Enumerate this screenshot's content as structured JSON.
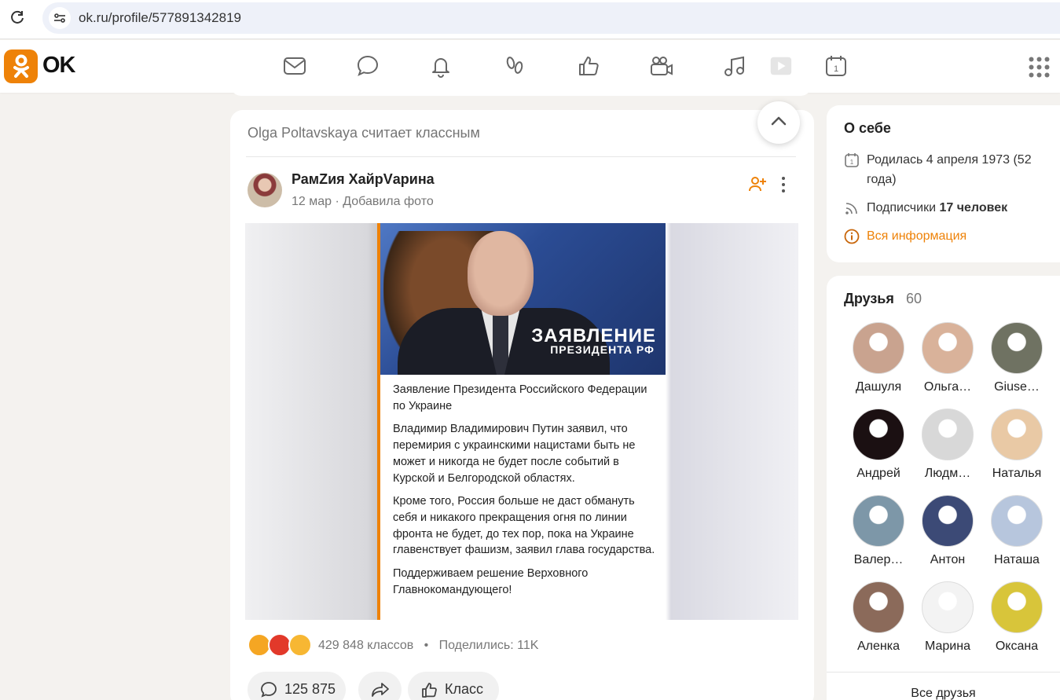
{
  "browser": {
    "url": "ok.ru/profile/577891342819"
  },
  "nav": {
    "logo_text": "OK",
    "icons": [
      "mail-icon",
      "chat-icon",
      "bell-icon",
      "guests-icon",
      "like-icon",
      "video-camera-icon",
      "music-icon",
      "video-play-icon",
      "calendar-icon"
    ]
  },
  "post": {
    "header": "Olga Poltavskaya считает классным",
    "author": "РамZия ХайрVарина",
    "meta": "12 мар · Добавила фото",
    "image": {
      "title": "ЗАЯВЛЕНИЕ",
      "subtitle": "ПРЕЗИДЕНТА РФ",
      "paragraphs": [
        "Заявление Президента Российского Федерации по Украине",
        "Владимир Владимирович Путин заявил, что перемирия с украинскими нацистами быть не может и никогда не будет после событий в Курской и Белгородской областях.",
        "Кроме того, Россия больше не даст обмануть себя и никакого прекращения огня по линии фронта не будет, до тех пор, пока на Украине главенствует фашизм, заявил глава государства.",
        "Поддерживаем решение Верховного Главнокомандующего!"
      ]
    },
    "reactions_text": "429 848 классов",
    "shares_text": "Поделились: 11K",
    "comment_count": "125 875",
    "class_label": "Класс"
  },
  "about": {
    "title": "О себе",
    "born": "Родилась 4 апреля 1973 (52 года)",
    "followers_label": "Подписчики",
    "followers_value": "17 человек",
    "all_info": "Вся информация"
  },
  "friends": {
    "title": "Друзья",
    "count": "60",
    "items": [
      {
        "name": "Дашуля",
        "color": "#c9a38f"
      },
      {
        "name": "Ольга…",
        "color": "#d9b29a"
      },
      {
        "name": "Giuse…",
        "color": "#6f7262"
      },
      {
        "name": "Андрей",
        "color": "#1b1012"
      },
      {
        "name": "Людм…",
        "color": "#d8d8d8"
      },
      {
        "name": "Наталья",
        "color": "#e9c9a5"
      },
      {
        "name": "Валер…",
        "color": "#7d97a8"
      },
      {
        "name": "Антон",
        "color": "#3c4a76"
      },
      {
        "name": "Наташа",
        "color": "#b7c6dd"
      },
      {
        "name": "Аленка",
        "color": "#8b6a5a"
      },
      {
        "name": "Марина",
        "color": "#f3f3f3"
      },
      {
        "name": "Оксана",
        "color": "#d8c53a"
      }
    ],
    "all_label": "Все друзья"
  }
}
